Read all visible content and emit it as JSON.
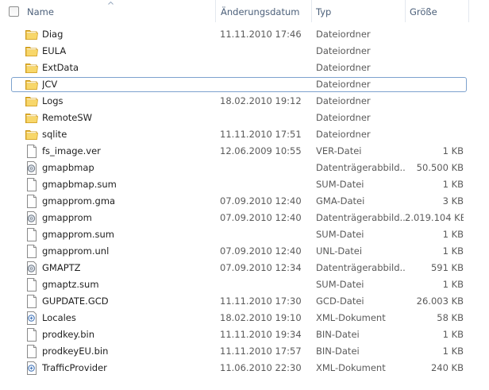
{
  "header": {
    "name": "Name",
    "date": "Änderungsdatum",
    "type": "Typ",
    "size": "Größe"
  },
  "rows": [
    {
      "name": "Diag",
      "date": "11.11.2010 17:46",
      "type": "Dateiordner",
      "size": "",
      "icon": "folder-icon"
    },
    {
      "name": "EULA",
      "date": "",
      "type": "Dateiordner",
      "size": "",
      "icon": "folder-icon"
    },
    {
      "name": "ExtData",
      "date": "",
      "type": "Dateiordner",
      "size": "",
      "icon": "folder-icon"
    },
    {
      "name": "JCV",
      "date": "",
      "type": "Dateiordner",
      "size": "",
      "icon": "folder-icon",
      "focused": true
    },
    {
      "name": "Logs",
      "date": "18.02.2010 19:12",
      "type": "Dateiordner",
      "size": "",
      "icon": "folder-icon"
    },
    {
      "name": "RemoteSW",
      "date": "",
      "type": "Dateiordner",
      "size": "",
      "icon": "folder-icon"
    },
    {
      "name": "sqlite",
      "date": "11.11.2010 17:51",
      "type": "Dateiordner",
      "size": "",
      "icon": "folder-icon"
    },
    {
      "name": "fs_image.ver",
      "date": "12.06.2009 10:55",
      "type": "VER-Datei",
      "size": "1 KB",
      "icon": "file-icon"
    },
    {
      "name": "gmapbmap",
      "date": "",
      "type": "Datenträgerabbild...",
      "size": "50.500 KB",
      "icon": "disk-image-icon"
    },
    {
      "name": "gmapbmap.sum",
      "date": "",
      "type": "SUM-Datei",
      "size": "1 KB",
      "icon": "file-icon"
    },
    {
      "name": "gmapprom.gma",
      "date": "07.09.2010 12:40",
      "type": "GMA-Datei",
      "size": "3 KB",
      "icon": "file-icon"
    },
    {
      "name": "gmapprom",
      "date": "07.09.2010 12:40",
      "type": "Datenträgerabbild...",
      "size": "2.019.104 KB",
      "icon": "disk-image-icon"
    },
    {
      "name": "gmapprom.sum",
      "date": "",
      "type": "SUM-Datei",
      "size": "1 KB",
      "icon": "file-icon"
    },
    {
      "name": "gmapprom.unl",
      "date": "07.09.2010 12:40",
      "type": "UNL-Datei",
      "size": "1 KB",
      "icon": "file-icon"
    },
    {
      "name": "GMAPTZ",
      "date": "07.09.2010 12:34",
      "type": "Datenträgerabbild...",
      "size": "591 KB",
      "icon": "disk-image-icon"
    },
    {
      "name": "gmaptz.sum",
      "date": "",
      "type": "SUM-Datei",
      "size": "1 KB",
      "icon": "file-icon"
    },
    {
      "name": "GUPDATE.GCD",
      "date": "11.11.2010 17:30",
      "type": "GCD-Datei",
      "size": "26.003 KB",
      "icon": "file-icon"
    },
    {
      "name": "Locales",
      "date": "18.02.2010 19:10",
      "type": "XML-Dokument",
      "size": "58 KB",
      "icon": "xml-file-icon"
    },
    {
      "name": "prodkey.bin",
      "date": "11.11.2010 19:34",
      "type": "BIN-Datei",
      "size": "1 KB",
      "icon": "file-icon"
    },
    {
      "name": "prodkeyEU.bin",
      "date": "11.11.2010 17:57",
      "type": "BIN-Datei",
      "size": "1 KB",
      "icon": "file-icon"
    },
    {
      "name": "TrafficProvider",
      "date": "11.06.2010 22:30",
      "type": "XML-Dokument",
      "size": "240 KB",
      "icon": "xml-file-icon"
    }
  ]
}
